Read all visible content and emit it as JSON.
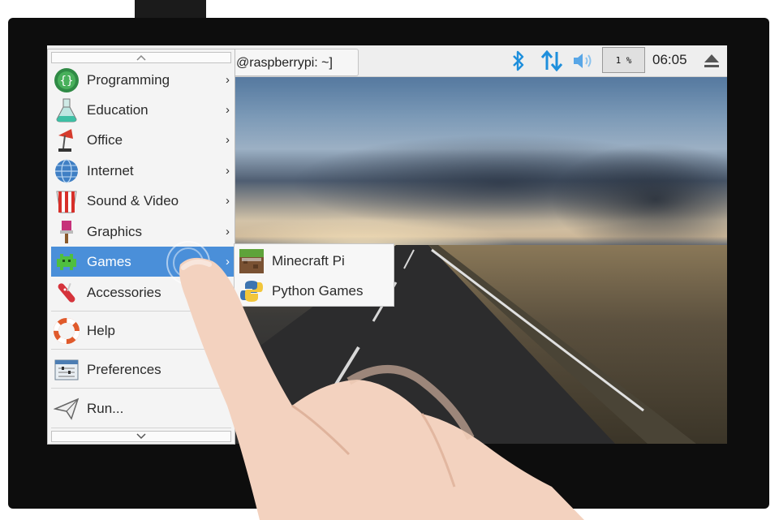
{
  "taskbar": {
    "terminal_title": "@raspberrypi: ~]",
    "cpu_usage": "1 %",
    "clock": "06:05",
    "tray_icons": [
      "bluetooth-icon",
      "network-icon",
      "volume-icon",
      "eject-icon"
    ],
    "accent_color": "#1e8fdc"
  },
  "menu": {
    "scroll_up_icon": "chevron-up-icon",
    "scroll_down_icon": "chevron-down-icon",
    "items": [
      {
        "label": "Programming",
        "icon": "programming-icon",
        "submenu": true
      },
      {
        "label": "Education",
        "icon": "education-icon",
        "submenu": true
      },
      {
        "label": "Office",
        "icon": "office-icon",
        "submenu": true
      },
      {
        "label": "Internet",
        "icon": "internet-icon",
        "submenu": true
      },
      {
        "label": "Sound & Video",
        "icon": "sound-video-icon",
        "submenu": true
      },
      {
        "label": "Graphics",
        "icon": "graphics-icon",
        "submenu": true
      },
      {
        "label": "Games",
        "icon": "games-icon",
        "submenu": true,
        "selected": true
      },
      {
        "label": "Accessories",
        "icon": "accessories-icon",
        "submenu": true
      },
      {
        "label": "Help",
        "icon": "help-icon",
        "submenu": false
      },
      {
        "label": "Preferences",
        "icon": "preferences-icon",
        "submenu": true
      },
      {
        "label": "Run...",
        "icon": "run-icon",
        "submenu": false
      }
    ],
    "highlight_color": "#4a8fd9"
  },
  "games_submenu": {
    "items": [
      {
        "label": "Minecraft Pi",
        "icon": "minecraft-icon"
      },
      {
        "label": "Python Games",
        "icon": "python-icon"
      }
    ]
  }
}
